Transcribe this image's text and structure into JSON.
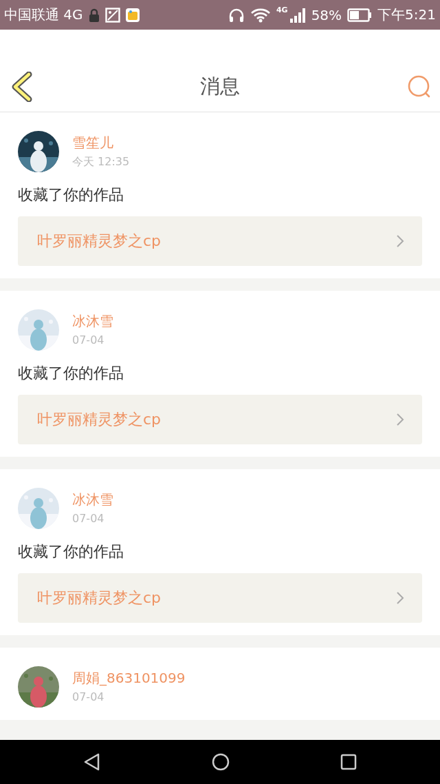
{
  "status_bar": {
    "carrier": "中国联通 4G",
    "network": "4G",
    "battery": "58%",
    "time": "下午5:21"
  },
  "header": {
    "title": "消息"
  },
  "messages": [
    {
      "name": "雪笙儿",
      "time": "今天 12:35",
      "action": "收藏了你的作品",
      "work": "叶罗丽精灵梦之cp"
    },
    {
      "name": "冰沐雪",
      "time": "07-04",
      "action": "收藏了你的作品",
      "work": "叶罗丽精灵梦之cp"
    },
    {
      "name": "冰沐雪",
      "time": "07-04",
      "action": "收藏了你的作品",
      "work": "叶罗丽精灵梦之cp"
    },
    {
      "name": "周娟_863101099",
      "time": "07-04"
    }
  ]
}
